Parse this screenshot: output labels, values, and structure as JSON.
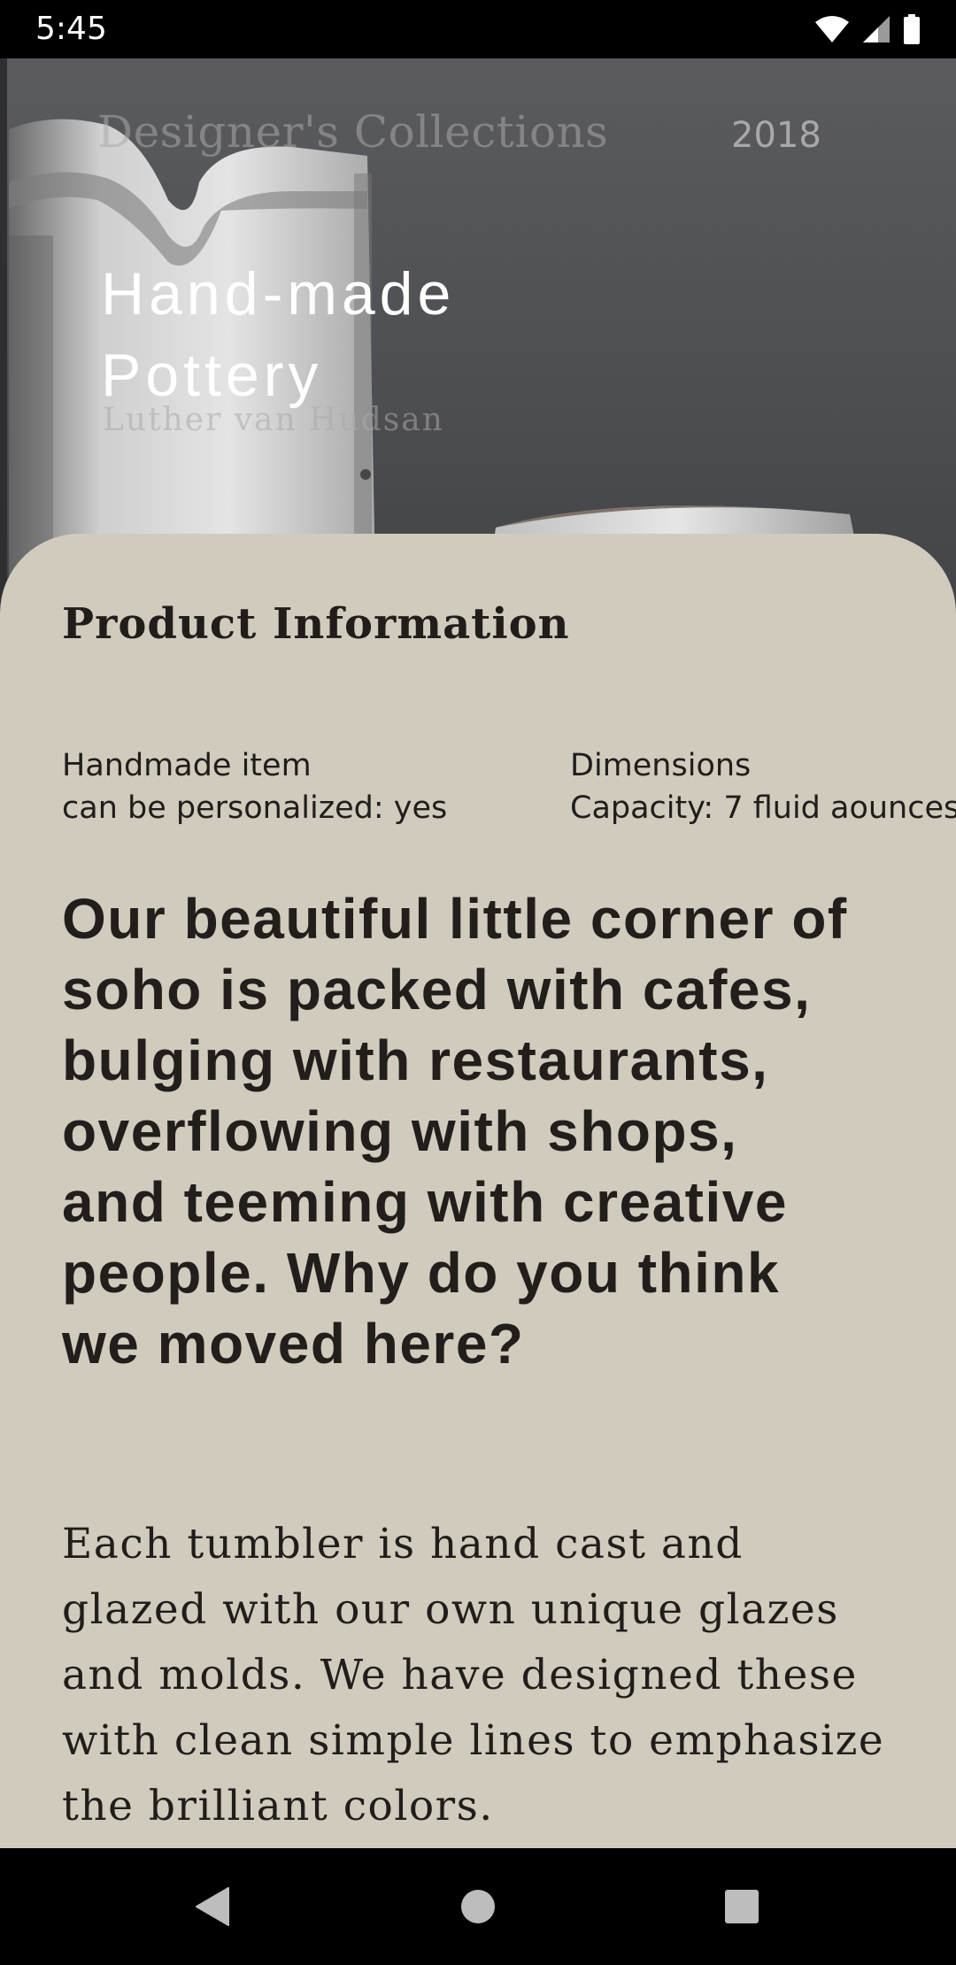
{
  "status_bar": {
    "time": "5:45",
    "icons": [
      "wifi-icon",
      "signal-icon",
      "battery-icon"
    ]
  },
  "hero": {
    "brand": "Designer's Collections",
    "year": "2018",
    "title": "Hand-made Pottery",
    "author": "Luther van Hudsan"
  },
  "product": {
    "section_title": "Product Information",
    "details_left": {
      "line1": "Handmade item",
      "line2": "can be personalized: yes"
    },
    "details_right": {
      "line1": "Dimensions",
      "line2": "Capacity: 7 fluid aounces"
    },
    "headline": "Our beautiful little corner of soho is packed with cafes, bulging with restaurants, overflowing with shops, and teeming with creative people. Why do you think we moved here?",
    "description": "Each tumbler is hand cast and glazed with our own unique glazes and molds. We have designed these with clean simple lines to emphasize the brilliant colors."
  },
  "nav_bar": {
    "buttons": [
      "back-icon",
      "home-icon",
      "recents-icon"
    ]
  },
  "colors": {
    "sheet_background": "#d0cbbd",
    "text_dark": "#201d1b",
    "hero_background": "#4f5054",
    "system_bar": "#000000"
  }
}
